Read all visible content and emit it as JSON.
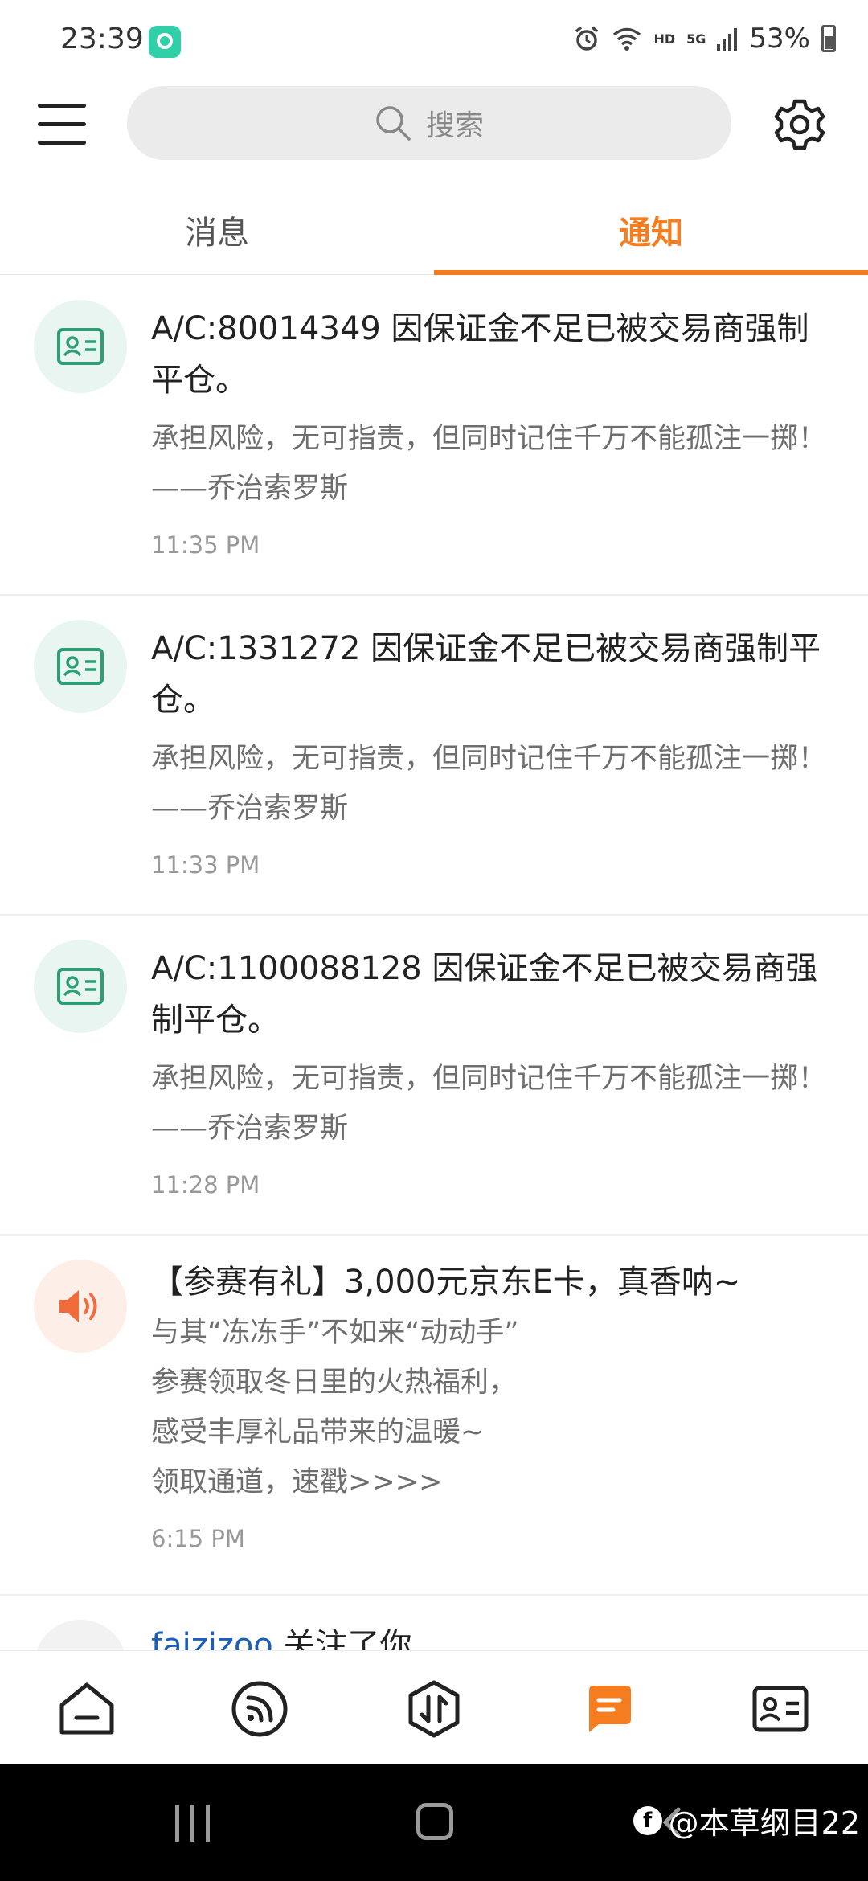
{
  "status_bar": {
    "time": "23:39",
    "network_hd": "HD",
    "network_5g": "5G",
    "battery": "53%"
  },
  "header": {
    "search_placeholder": "搜索"
  },
  "tabs": [
    {
      "label": "消息",
      "active": false
    },
    {
      "label": "通知",
      "active": true
    }
  ],
  "notifications": [
    {
      "icon": "id-card-icon",
      "title": "A/C:80014349  因保证金不足已被交易商强制平仓。",
      "body": "承担风险，无可指责，但同时记住千万不能孤注一掷！——乔治索罗斯",
      "time": "11:35 PM"
    },
    {
      "icon": "id-card-icon",
      "title": "A/C:1331272  因保证金不足已被交易商强制平仓。",
      "body": "承担风险，无可指责，但同时记住千万不能孤注一掷！——乔治索罗斯",
      "time": "11:33 PM"
    },
    {
      "icon": "id-card-icon",
      "title": "A/C:1100088128  因保证金不足已被交易商强制平仓。",
      "body": "承担风险，无可指责，但同时记住千万不能孤注一掷！——乔治索罗斯",
      "time": "11:28 PM"
    },
    {
      "icon": "speaker-icon",
      "title": "【参赛有礼】3,000元京东E卡，真香呐~",
      "body_lines": [
        "与其“冻冻手”不如来“动动手”",
        "参赛领取冬日里的火热福利，",
        "感受丰厚礼品带来的温暖~",
        "领取通道，速戳>>>>"
      ],
      "time": "6:15 PM"
    },
    {
      "user": "faizizoo",
      "action": " 关注了你"
    }
  ],
  "bottom_nav": [
    {
      "icon": "home-icon"
    },
    {
      "icon": "feed-icon"
    },
    {
      "icon": "trade-icon"
    },
    {
      "icon": "message-icon",
      "active": true
    },
    {
      "icon": "profile-card-icon"
    }
  ],
  "watermark": {
    "logo": "f",
    "text": "@本草纲目22"
  },
  "colors": {
    "accent": "#f57c1f",
    "green_icon": "#2e9e74",
    "link_blue": "#1b5fb8"
  }
}
